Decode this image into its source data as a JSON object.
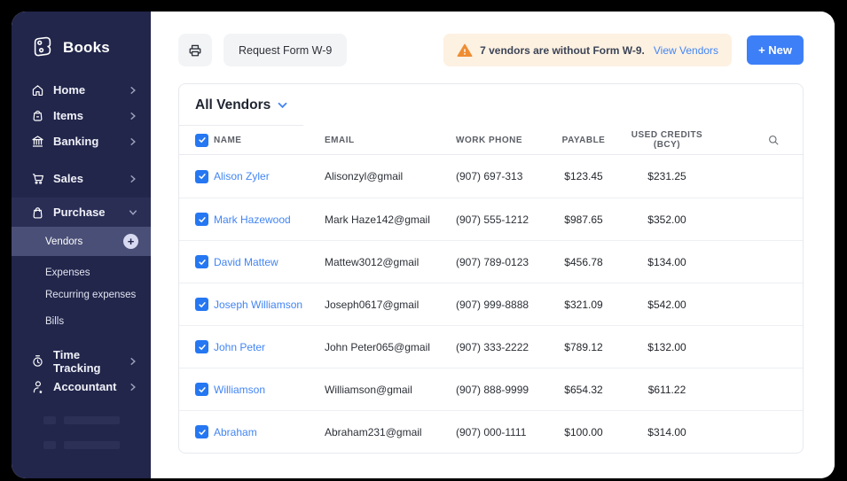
{
  "colors": {
    "sidebar_bg": "#22264b",
    "sidebar_active_bg": "#4a4f77",
    "accent_blue": "#3d7ff7",
    "link_blue": "#4285f4",
    "warning_bg": "#fdf1e2",
    "warning_icon": "#ef8d32",
    "checkbox_blue": "#2577f2"
  },
  "icons": {
    "books-logo-icon": "stylized-b-with-dots",
    "home-icon": "house",
    "items-icon": "bag-minus",
    "banking-icon": "bank-columns",
    "sales-icon": "shopping-cart",
    "purchase-icon": "handbag",
    "time-tracking-icon": "stopwatch",
    "accountant-icon": "person-star",
    "printer-icon": "printer",
    "warning-icon": "orange-triangle-exclamation",
    "search-icon": "magnifier",
    "plus-circle-icon": "+",
    "chevron-right-icon": "›",
    "chevron-down-icon": "⌄"
  },
  "sidebar": {
    "brand": "Books",
    "items": [
      {
        "label": "Home"
      },
      {
        "label": "Items"
      },
      {
        "label": "Banking"
      },
      {
        "label": "Sales"
      },
      {
        "label": "Purchase"
      },
      {
        "label": "Time Tracking"
      },
      {
        "label": "Accountant"
      }
    ],
    "purchase_children": [
      {
        "label": "Vendors",
        "active": true
      },
      {
        "label": "Expenses"
      },
      {
        "label": "Recurring expenses"
      },
      {
        "label": "Bills"
      }
    ]
  },
  "toolbar": {
    "request_w9_label": "Request Form W-9",
    "alert_text": "7 vendors are without Form W-9.",
    "alert_link": "View Vendors",
    "new_label": "+ New"
  },
  "table": {
    "filter_label": "All Vendors",
    "columns": [
      "NAME",
      "EMAIL",
      "WORK PHONE",
      "PAYABLE",
      "USED CREDITS (BCY)"
    ],
    "rows": [
      {
        "name": "Alison Zyler",
        "email": "Alisonzyl@gmail",
        "phone": "(907) 697-313",
        "payable": "$123.45",
        "used_credits": "$231.25"
      },
      {
        "name": "Mark Hazewood",
        "email": "Mark Haze142@gmail",
        "phone": "(907) 555-1212",
        "payable": "$987.65",
        "used_credits": "$352.00"
      },
      {
        "name": "David Mattew",
        "email": "Mattew3012@gmail",
        "phone": "(907) 789-0123",
        "payable": "$456.78",
        "used_credits": "$134.00"
      },
      {
        "name": "Joseph Williamson",
        "email": "Joseph0617@gmail",
        "phone": "(907) 999-8888",
        "payable": "$321.09",
        "used_credits": "$542.00"
      },
      {
        "name": "John Peter",
        "email": "John Peter065@gmail",
        "phone": "(907) 333-2222",
        "payable": "$789.12",
        "used_credits": "$132.00"
      },
      {
        "name": "Williamson",
        "email": "Williamson@gmail",
        "phone": "(907) 888-9999",
        "payable": "$654.32",
        "used_credits": "$611.22"
      },
      {
        "name": "Abraham",
        "email": "Abraham231@gmail",
        "phone": "(907) 000-1111",
        "payable": "$100.00",
        "used_credits": "$314.00"
      }
    ]
  }
}
